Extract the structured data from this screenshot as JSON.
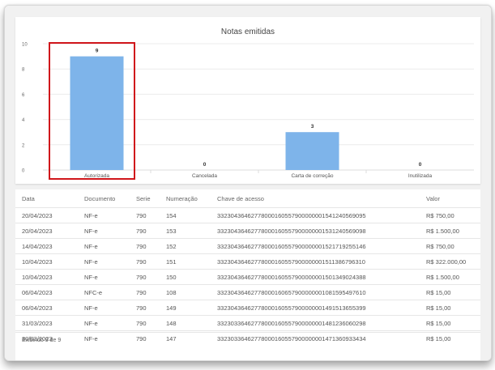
{
  "chart_data": {
    "type": "bar",
    "title": "Notas emitidas",
    "categories": [
      "Autorizada",
      "Cancelada",
      "Carta de correção",
      "Inutilizada"
    ],
    "values": [
      9,
      0,
      3,
      0
    ],
    "ylim": [
      0,
      10
    ],
    "yticks": [
      "0",
      "2",
      "4",
      "6",
      "8",
      "10"
    ],
    "grid": true,
    "bar_color": "#7eb4ea",
    "highlighted_category": "Autorizada",
    "highlight_color": "#d0161b"
  },
  "table": {
    "columns": [
      "Data",
      "Documento",
      "Serie",
      "Numeração",
      "Chave de acesso",
      "Valor"
    ],
    "rows": [
      [
        "20/04/2023",
        "NF-e",
        "790",
        "154",
        "33230436462778000160557900000001541240569095",
        "R$ 750,00"
      ],
      [
        "20/04/2023",
        "NF-e",
        "790",
        "153",
        "33230436462778000160557900000001531240569098",
        "R$ 1.500,00"
      ],
      [
        "14/04/2023",
        "NF-e",
        "790",
        "152",
        "33230436462778000160557900000001521719255146",
        "R$ 750,00"
      ],
      [
        "10/04/2023",
        "NF-e",
        "790",
        "151",
        "33230436462778000160557900000001511386796310",
        "R$ 322.000,00"
      ],
      [
        "10/04/2023",
        "NF-e",
        "790",
        "150",
        "33230436462778000160557900000001501349024388",
        "R$ 1.500,00"
      ],
      [
        "06/04/2023",
        "NFC-e",
        "790",
        "108",
        "33230436462778000160657900000001081595497610",
        "R$ 15,00"
      ],
      [
        "06/04/2023",
        "NF-e",
        "790",
        "149",
        "33230436462778000160557900000001491513655399",
        "R$ 15,00"
      ],
      [
        "31/03/2023",
        "NF-e",
        "790",
        "148",
        "33230336462778000160557900000001481236060298",
        "R$ 15,00"
      ],
      [
        "30/03/2023",
        "NF-e",
        "790",
        "147",
        "33230336462778000160557900000001471360933434",
        "R$ 15,00"
      ]
    ]
  },
  "footer": {
    "text": "Exibindo 9 de 9"
  }
}
